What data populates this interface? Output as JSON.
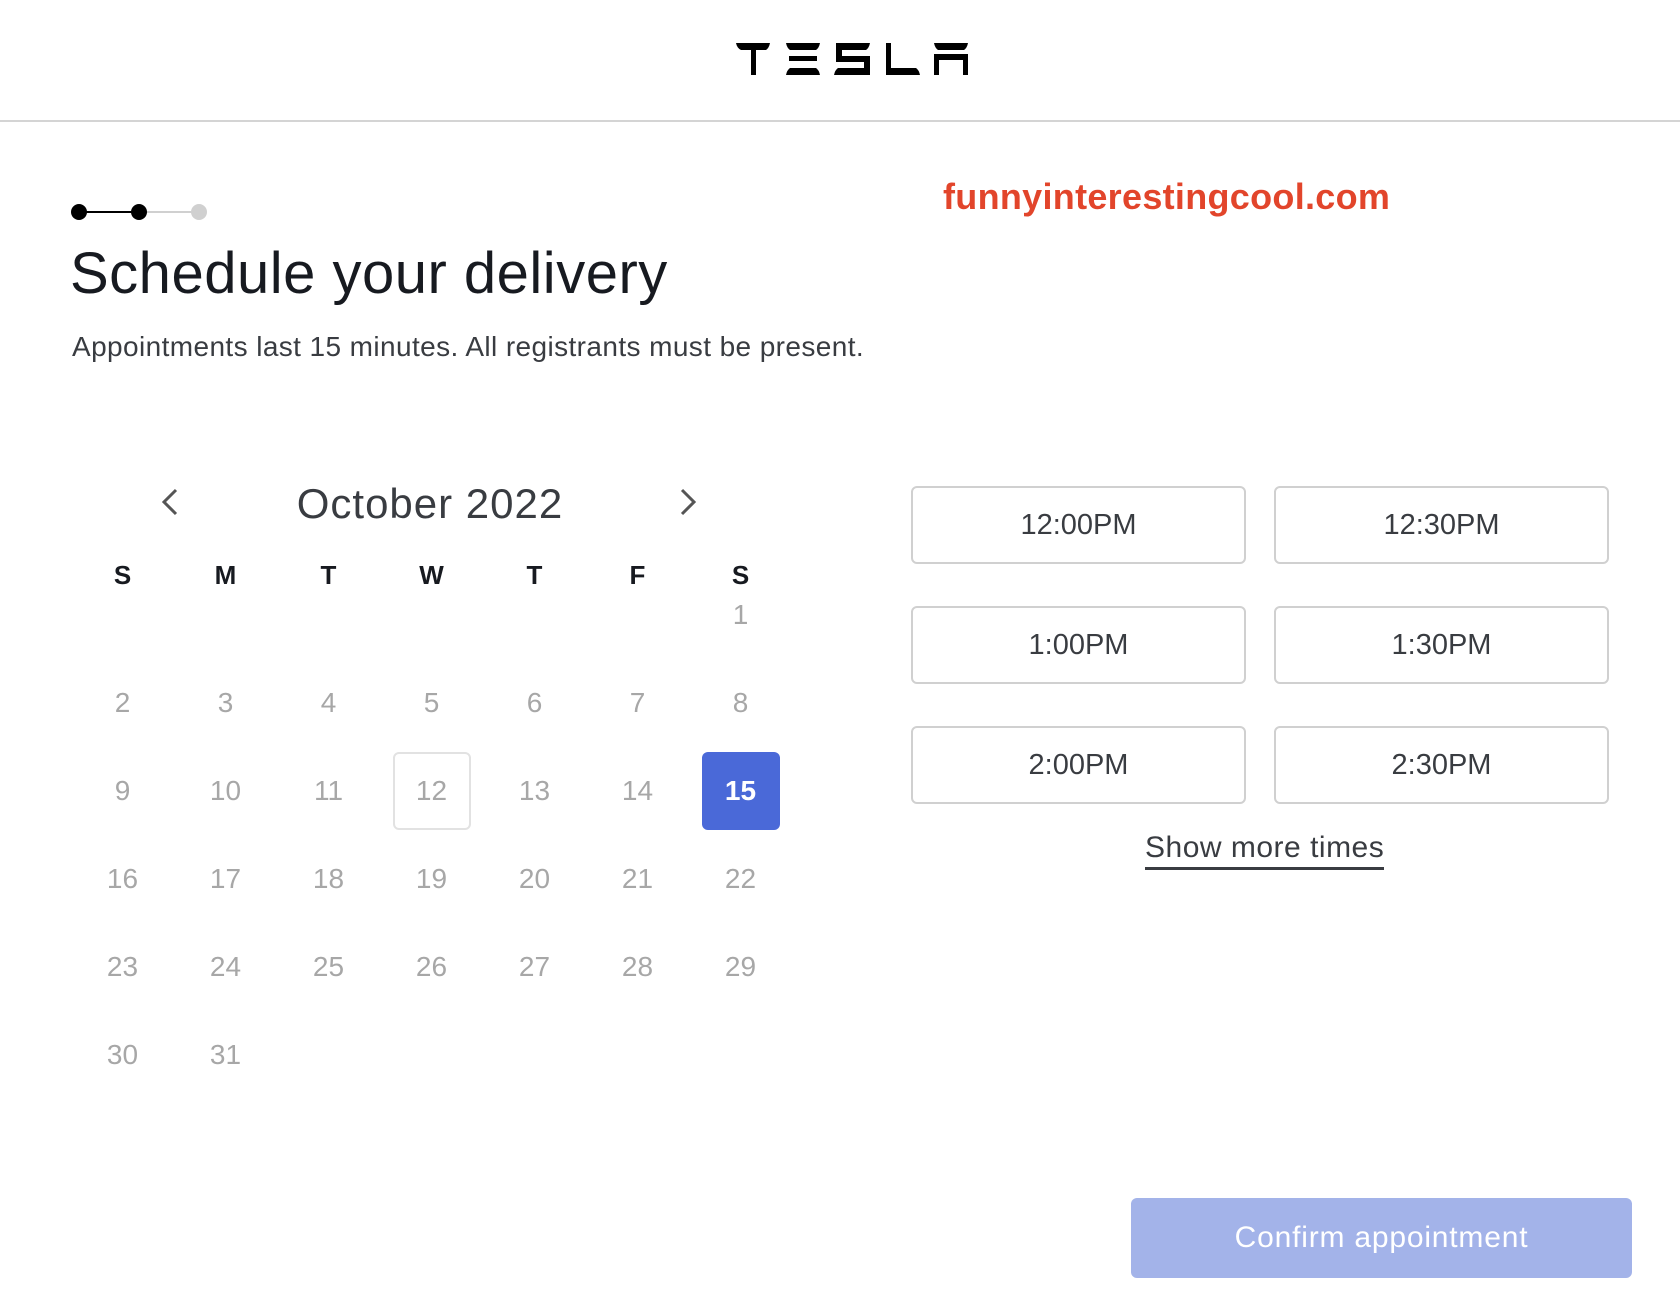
{
  "header": {
    "brand": "TESLA",
    "logo_icon": "tesla-wordmark-icon"
  },
  "watermark": "funnyinterestingcool.com",
  "stepper": {
    "total_steps": 3,
    "completed_steps": 2,
    "active_color": "#000000",
    "inactive_color": "#d0d0d0"
  },
  "page": {
    "title": "Schedule your delivery",
    "subtitle": "Appointments last 15 minutes. All registrants must be present."
  },
  "calendar": {
    "month_label": "October 2022",
    "prev_icon": "chevron-left-icon",
    "next_icon": "chevron-right-icon",
    "weekdays": [
      "S",
      "M",
      "T",
      "W",
      "T",
      "F",
      "S"
    ],
    "first_weekday_index": 6,
    "days_in_month": 31,
    "days": [
      "1",
      "2",
      "3",
      "4",
      "5",
      "6",
      "7",
      "8",
      "9",
      "10",
      "11",
      "12",
      "13",
      "14",
      "15",
      "16",
      "17",
      "18",
      "19",
      "20",
      "21",
      "22",
      "23",
      "24",
      "25",
      "26",
      "27",
      "28",
      "29",
      "30",
      "31"
    ],
    "today": "12",
    "selected": "15",
    "selected_color": "#4a69d8"
  },
  "times": {
    "slots": [
      "12:00PM",
      "12:30PM",
      "1:00PM",
      "1:30PM",
      "2:00PM",
      "2:30PM"
    ],
    "show_more_label": "Show more times"
  },
  "actions": {
    "confirm_label": "Confirm appointment",
    "confirm_enabled": false,
    "confirm_color": "#a3b3e9"
  }
}
